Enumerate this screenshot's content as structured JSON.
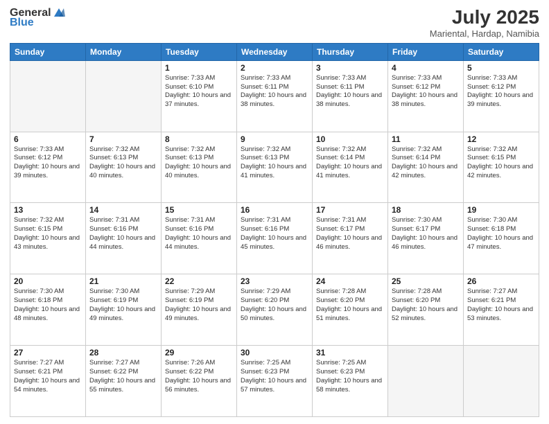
{
  "header": {
    "logo_general": "General",
    "logo_blue": "Blue",
    "month_title": "July 2025",
    "location": "Mariental, Hardap, Namibia"
  },
  "days_of_week": [
    "Sunday",
    "Monday",
    "Tuesday",
    "Wednesday",
    "Thursday",
    "Friday",
    "Saturday"
  ],
  "weeks": [
    [
      {
        "day": "",
        "info": ""
      },
      {
        "day": "",
        "info": ""
      },
      {
        "day": "1",
        "info": "Sunrise: 7:33 AM\nSunset: 6:10 PM\nDaylight: 10 hours and 37 minutes."
      },
      {
        "day": "2",
        "info": "Sunrise: 7:33 AM\nSunset: 6:11 PM\nDaylight: 10 hours and 38 minutes."
      },
      {
        "day": "3",
        "info": "Sunrise: 7:33 AM\nSunset: 6:11 PM\nDaylight: 10 hours and 38 minutes."
      },
      {
        "day": "4",
        "info": "Sunrise: 7:33 AM\nSunset: 6:12 PM\nDaylight: 10 hours and 38 minutes."
      },
      {
        "day": "5",
        "info": "Sunrise: 7:33 AM\nSunset: 6:12 PM\nDaylight: 10 hours and 39 minutes."
      }
    ],
    [
      {
        "day": "6",
        "info": "Sunrise: 7:33 AM\nSunset: 6:12 PM\nDaylight: 10 hours and 39 minutes."
      },
      {
        "day": "7",
        "info": "Sunrise: 7:32 AM\nSunset: 6:13 PM\nDaylight: 10 hours and 40 minutes."
      },
      {
        "day": "8",
        "info": "Sunrise: 7:32 AM\nSunset: 6:13 PM\nDaylight: 10 hours and 40 minutes."
      },
      {
        "day": "9",
        "info": "Sunrise: 7:32 AM\nSunset: 6:13 PM\nDaylight: 10 hours and 41 minutes."
      },
      {
        "day": "10",
        "info": "Sunrise: 7:32 AM\nSunset: 6:14 PM\nDaylight: 10 hours and 41 minutes."
      },
      {
        "day": "11",
        "info": "Sunrise: 7:32 AM\nSunset: 6:14 PM\nDaylight: 10 hours and 42 minutes."
      },
      {
        "day": "12",
        "info": "Sunrise: 7:32 AM\nSunset: 6:15 PM\nDaylight: 10 hours and 42 minutes."
      }
    ],
    [
      {
        "day": "13",
        "info": "Sunrise: 7:32 AM\nSunset: 6:15 PM\nDaylight: 10 hours and 43 minutes."
      },
      {
        "day": "14",
        "info": "Sunrise: 7:31 AM\nSunset: 6:16 PM\nDaylight: 10 hours and 44 minutes."
      },
      {
        "day": "15",
        "info": "Sunrise: 7:31 AM\nSunset: 6:16 PM\nDaylight: 10 hours and 44 minutes."
      },
      {
        "day": "16",
        "info": "Sunrise: 7:31 AM\nSunset: 6:16 PM\nDaylight: 10 hours and 45 minutes."
      },
      {
        "day": "17",
        "info": "Sunrise: 7:31 AM\nSunset: 6:17 PM\nDaylight: 10 hours and 46 minutes."
      },
      {
        "day": "18",
        "info": "Sunrise: 7:30 AM\nSunset: 6:17 PM\nDaylight: 10 hours and 46 minutes."
      },
      {
        "day": "19",
        "info": "Sunrise: 7:30 AM\nSunset: 6:18 PM\nDaylight: 10 hours and 47 minutes."
      }
    ],
    [
      {
        "day": "20",
        "info": "Sunrise: 7:30 AM\nSunset: 6:18 PM\nDaylight: 10 hours and 48 minutes."
      },
      {
        "day": "21",
        "info": "Sunrise: 7:30 AM\nSunset: 6:19 PM\nDaylight: 10 hours and 49 minutes."
      },
      {
        "day": "22",
        "info": "Sunrise: 7:29 AM\nSunset: 6:19 PM\nDaylight: 10 hours and 49 minutes."
      },
      {
        "day": "23",
        "info": "Sunrise: 7:29 AM\nSunset: 6:20 PM\nDaylight: 10 hours and 50 minutes."
      },
      {
        "day": "24",
        "info": "Sunrise: 7:28 AM\nSunset: 6:20 PM\nDaylight: 10 hours and 51 minutes."
      },
      {
        "day": "25",
        "info": "Sunrise: 7:28 AM\nSunset: 6:20 PM\nDaylight: 10 hours and 52 minutes."
      },
      {
        "day": "26",
        "info": "Sunrise: 7:27 AM\nSunset: 6:21 PM\nDaylight: 10 hours and 53 minutes."
      }
    ],
    [
      {
        "day": "27",
        "info": "Sunrise: 7:27 AM\nSunset: 6:21 PM\nDaylight: 10 hours and 54 minutes."
      },
      {
        "day": "28",
        "info": "Sunrise: 7:27 AM\nSunset: 6:22 PM\nDaylight: 10 hours and 55 minutes."
      },
      {
        "day": "29",
        "info": "Sunrise: 7:26 AM\nSunset: 6:22 PM\nDaylight: 10 hours and 56 minutes."
      },
      {
        "day": "30",
        "info": "Sunrise: 7:25 AM\nSunset: 6:23 PM\nDaylight: 10 hours and 57 minutes."
      },
      {
        "day": "31",
        "info": "Sunrise: 7:25 AM\nSunset: 6:23 PM\nDaylight: 10 hours and 58 minutes."
      },
      {
        "day": "",
        "info": ""
      },
      {
        "day": "",
        "info": ""
      }
    ]
  ]
}
